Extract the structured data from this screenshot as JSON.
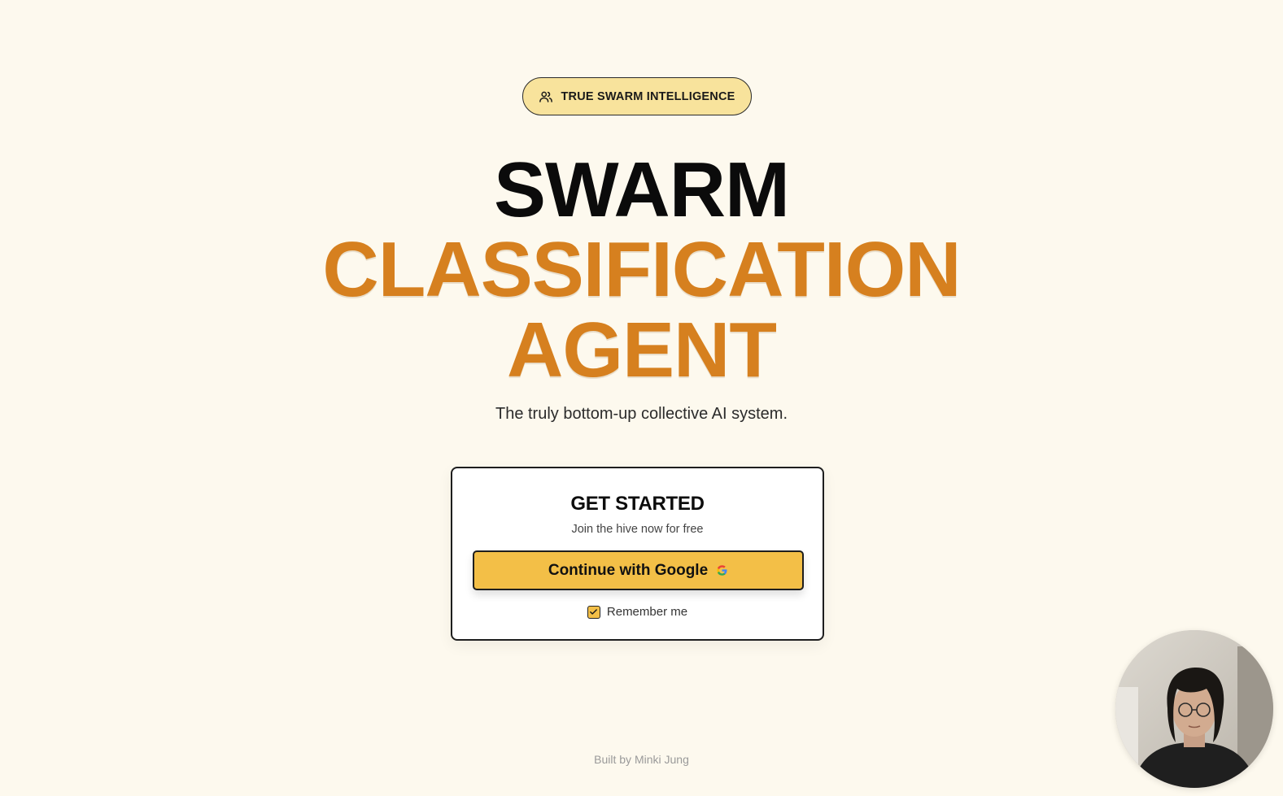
{
  "badge": {
    "icon": "users-icon",
    "label": "TRUE SWARM INTELLIGENCE"
  },
  "hero": {
    "line1": "SWARM",
    "line2": "CLASSIFICATION",
    "line3": "AGENT",
    "subtitle": "The truly bottom-up collective AI system."
  },
  "card": {
    "title": "GET STARTED",
    "subtitle": "Join the hive now for free",
    "google_button_label": "Continue with Google",
    "google_icon": "google-icon",
    "remember_label": "Remember me",
    "remember_checked": true
  },
  "footer": {
    "credit": "Built by Minki Jung"
  },
  "colors": {
    "background": "#fdf9ee",
    "accent_orange": "#d6801f",
    "button_yellow": "#f3bf47",
    "badge_yellow": "#f8e39c"
  }
}
